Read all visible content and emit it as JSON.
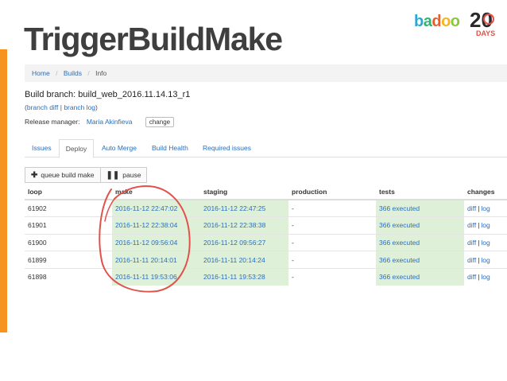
{
  "slide": {
    "title": "TriggerBuildMake",
    "accent_color": "#f7941d"
  },
  "logo": {
    "letters": [
      "b",
      "a",
      "d",
      "o",
      "o"
    ],
    "anniversary": "20",
    "anniversary_caption": "DAYS"
  },
  "breadcrumb": {
    "items": [
      {
        "label": "Home"
      },
      {
        "label": "Builds"
      },
      {
        "label": "Info"
      }
    ],
    "separator": "/"
  },
  "build": {
    "branch_label": "Build branch: build_web_2016.11.14.13_r1",
    "links_open": "(",
    "branch_diff": "branch diff",
    "links_sep": " | ",
    "branch_log": "branch log",
    "links_close": ")",
    "release_manager_label": "Release manager:",
    "release_manager_name": "Maria Akinfieva",
    "change_label": "change"
  },
  "tabs": [
    {
      "label": "Issues",
      "active": false
    },
    {
      "label": "Deploy",
      "active": true
    },
    {
      "label": "Auto Merge",
      "active": false
    },
    {
      "label": "Build Health",
      "active": false
    },
    {
      "label": "Required issues",
      "active": false
    }
  ],
  "toolbar": {
    "queue_icon": "plus-icon",
    "queue_label": "queue build make",
    "pause_icon": "pause-icon",
    "pause_label": "pause"
  },
  "table": {
    "columns": [
      "loop",
      "make",
      "staging",
      "production",
      "tests",
      "changes"
    ],
    "rows": [
      {
        "loop": "61902",
        "make": "2016-11-12 22:47:02",
        "staging": "2016-11-12 22:47:25",
        "production": "-",
        "tests": "366 executed",
        "diff": "diff",
        "sep": "|",
        "log": "log"
      },
      {
        "loop": "61901",
        "make": "2016-11-12 22:38:04",
        "staging": "2016-11-12 22:38:38",
        "production": "-",
        "tests": "366 executed",
        "diff": "diff",
        "sep": "|",
        "log": "log"
      },
      {
        "loop": "61900",
        "make": "2016-11-12 09:56:04",
        "staging": "2016-11-12 09:56:27",
        "production": "-",
        "tests": "366 executed",
        "diff": "diff",
        "sep": "|",
        "log": "log"
      },
      {
        "loop": "61899",
        "make": "2016-11-11 20:14:01",
        "staging": "2016-11-11 20:14:24",
        "production": "-",
        "tests": "366 executed",
        "diff": "diff",
        "sep": "|",
        "log": "log"
      },
      {
        "loop": "61898",
        "make": "2016-11-11 19:53:06",
        "staging": "2016-11-11 19:53:28",
        "production": "-",
        "tests": "366 executed",
        "diff": "diff",
        "sep": "|",
        "log": "log"
      }
    ]
  },
  "annotation": {
    "color": "#e0524a"
  }
}
